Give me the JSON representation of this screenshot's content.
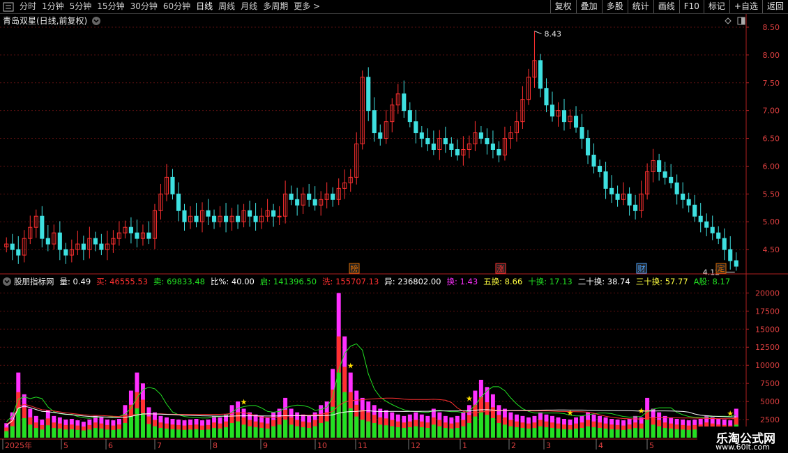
{
  "toolbar": {
    "periods": [
      "分时",
      "1分钟",
      "5分钟",
      "15分钟",
      "30分钟",
      "60分钟",
      "日线",
      "周线",
      "月线",
      "多周期",
      "更多 >"
    ],
    "active_period": "日线",
    "buttons": [
      "复权",
      "叠加",
      "多股",
      "统计",
      "画线",
      "F10",
      "标记",
      "+自选",
      "返回"
    ]
  },
  "main_panel": {
    "title": "青岛双星(日线,前复权)",
    "y_ticks": [
      "8.50",
      "8.00",
      "7.50",
      "7.00",
      "6.50",
      "6.00",
      "5.50",
      "5.00",
      "4.50"
    ],
    "high_label": "8.43",
    "low_label": "4.12",
    "event_tags": [
      {
        "text": "榜",
        "color": "#e06c00"
      },
      {
        "text": "涨",
        "color": "#ff3030"
      },
      {
        "text": "财",
        "color": "#4aa3ff"
      },
      {
        "text": "定",
        "color": "#e06c00"
      }
    ]
  },
  "indicator": {
    "name": "股朋指标网",
    "fields": [
      {
        "label": "量: ",
        "value": "0.49",
        "color": "#ffffff"
      },
      {
        "label": "买: ",
        "value": "46555.53",
        "color": "#ff3030"
      },
      {
        "label": "卖: ",
        "value": "69833.48",
        "color": "#22e022"
      },
      {
        "label": "比%: ",
        "value": "40.00",
        "color": "#ffffff"
      },
      {
        "label": "启: ",
        "value": "141396.50",
        "color": "#22e022"
      },
      {
        "label": "洗: ",
        "value": "155707.13",
        "color": "#ff3030"
      },
      {
        "label": "异: ",
        "value": "236802.00",
        "color": "#ffffff"
      },
      {
        "label": "换: ",
        "value": "1.43",
        "color": "#ff30ff"
      },
      {
        "label": "五换: ",
        "value": "8.66",
        "color": "#ffff40"
      },
      {
        "label": "十换: ",
        "value": "17.13",
        "color": "#22e022"
      },
      {
        "label": "二十换: ",
        "value": "38.74",
        "color": "#ffffff"
      },
      {
        "label": "三十换: ",
        "value": "57.77",
        "color": "#ffff40"
      },
      {
        "label": "A股: ",
        "value": "8.17",
        "color": "#22e022"
      }
    ],
    "y_ticks": [
      "20000",
      "17500",
      "15000",
      "12500",
      "10000",
      "7500",
      "5000",
      "2500"
    ]
  },
  "x_axis": {
    "labels": [
      "2025年",
      "5",
      "6",
      "7",
      "8",
      "9",
      "10",
      "11",
      "12",
      "1",
      "2",
      "3",
      "4",
      "5"
    ]
  },
  "watermark": {
    "main": "乐淘公式网",
    "sub": "www.60lt.com"
  },
  "colors": {
    "up": "#ff3030",
    "down": "#3ee0e0",
    "axis": "#b02020",
    "grid": "#5a1010",
    "buy": "#ff3030",
    "sell": "#22e022",
    "turnover": "#ff30ff",
    "line_white": "#ffffff",
    "line_green": "#22e022",
    "line_red": "#ff3030"
  },
  "chart_data": {
    "type": "candlestick",
    "title": "青岛双星(日线,前复权)",
    "ylim": [
      4.1,
      8.55
    ],
    "max_price": 8.43,
    "min_price": 4.12,
    "volume_ylim": [
      0,
      21000
    ],
    "closes": [
      4.6,
      4.5,
      4.4,
      4.7,
      4.9,
      5.1,
      4.7,
      4.6,
      4.8,
      4.5,
      4.4,
      4.5,
      4.6,
      4.5,
      4.7,
      4.6,
      4.5,
      4.6,
      4.7,
      4.8,
      4.9,
      4.8,
      4.7,
      4.8,
      4.7,
      5.2,
      5.5,
      5.8,
      5.5,
      5.2,
      5.0,
      5.1,
      5.0,
      5.2,
      5.1,
      5.0,
      5.1,
      5.0,
      5.1,
      5.0,
      5.2,
      5.1,
      5.0,
      5.1,
      5.2,
      5.1,
      5.1,
      5.5,
      5.4,
      5.3,
      5.5,
      5.4,
      5.3,
      5.4,
      5.5,
      5.4,
      5.6,
      5.7,
      5.8,
      6.4,
      7.6,
      7.0,
      6.6,
      6.5,
      6.8,
      7.1,
      7.3,
      7.0,
      6.8,
      6.6,
      6.5,
      6.4,
      6.3,
      6.5,
      6.4,
      6.3,
      6.2,
      6.3,
      6.4,
      6.6,
      6.5,
      6.4,
      6.3,
      6.2,
      6.5,
      6.6,
      6.8,
      7.2,
      7.6,
      7.9,
      7.4,
      7.1,
      6.9,
      7.0,
      6.8,
      6.9,
      6.7,
      6.5,
      6.2,
      6.0,
      5.9,
      5.6,
      5.5,
      5.4,
      5.5,
      5.3,
      5.2,
      5.5,
      5.9,
      6.1,
      5.9,
      5.8,
      5.7,
      5.5,
      5.4,
      5.3,
      5.1,
      5.0,
      4.9,
      4.8,
      4.7,
      4.5,
      4.3,
      4.2
    ],
    "volumes": [
      2000,
      3500,
      9000,
      6000,
      4000,
      3000,
      2500,
      3800,
      3000,
      2800,
      2500,
      2600,
      2400,
      2200,
      2500,
      3000,
      2800,
      2500,
      2400,
      2600,
      4500,
      6500,
      9000,
      7500,
      4200,
      3500,
      3000,
      2800,
      2600,
      2500,
      2400,
      2500,
      2600,
      2400,
      2500,
      3000,
      2800,
      3200,
      4500,
      5000,
      4000,
      3500,
      3200,
      3000,
      2800,
      3500,
      4000,
      5500,
      4000,
      3500,
      3200,
      3000,
      3500,
      4500,
      5000,
      9500,
      20000,
      14000,
      9000,
      6500,
      5500,
      5000,
      4500,
      4000,
      3800,
      3500,
      3200,
      3000,
      3200,
      3500,
      3200,
      3000,
      4000,
      3500,
      3000,
      2800,
      3000,
      3500,
      4500,
      6500,
      8000,
      7000,
      6000,
      4500,
      4000,
      3500,
      3200,
      3000,
      2800,
      3000,
      3500,
      3200,
      3000,
      2800,
      2600,
      2500,
      2800,
      3000,
      3500,
      3200,
      3000,
      2800,
      2600,
      2500,
      2400,
      2600,
      3000,
      2800,
      5500,
      4000,
      3500,
      3000,
      2800,
      2600,
      2500,
      2400,
      2500,
      2600,
      3000,
      2800,
      2600,
      2500,
      2400,
      4000
    ]
  }
}
